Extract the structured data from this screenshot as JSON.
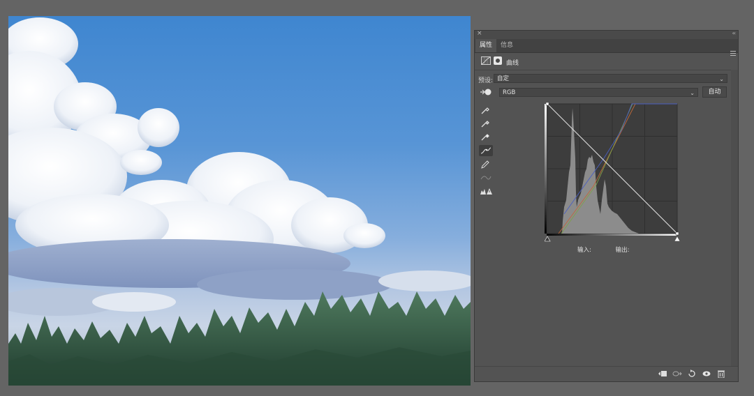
{
  "photo": {
    "description_icon": "landscape-photo-canvas"
  },
  "panel": {
    "tabs": [
      {
        "label": "属性",
        "active": true
      },
      {
        "label": "信息",
        "active": false
      }
    ],
    "adjustment_title": "曲线",
    "preset_label": "预设:",
    "preset_value": "自定",
    "channel_value": "RGB",
    "auto_button": "自动",
    "input_label": "输入:",
    "output_label": "输出:",
    "tools": [
      "eyedropper-black-icon",
      "eyedropper-gray-icon",
      "eyedropper-white-icon",
      "curve-point-icon",
      "pencil-icon",
      "smooth-icon",
      "clipping-warning-icon"
    ],
    "bottom_icons": [
      "clip-to-layer-icon",
      "view-previous-state-icon",
      "reset-icon",
      "visibility-eye-icon",
      "delete-icon"
    ]
  },
  "colors": {
    "panel_bg": "#535353",
    "workspace_bg": "#646464",
    "histogram": "#8c8c8c",
    "curve_line": "#e6e6e6",
    "red_curve": "#c06a3a",
    "green_curve": "#7fa04a",
    "blue_curve": "#4a5fc0"
  }
}
